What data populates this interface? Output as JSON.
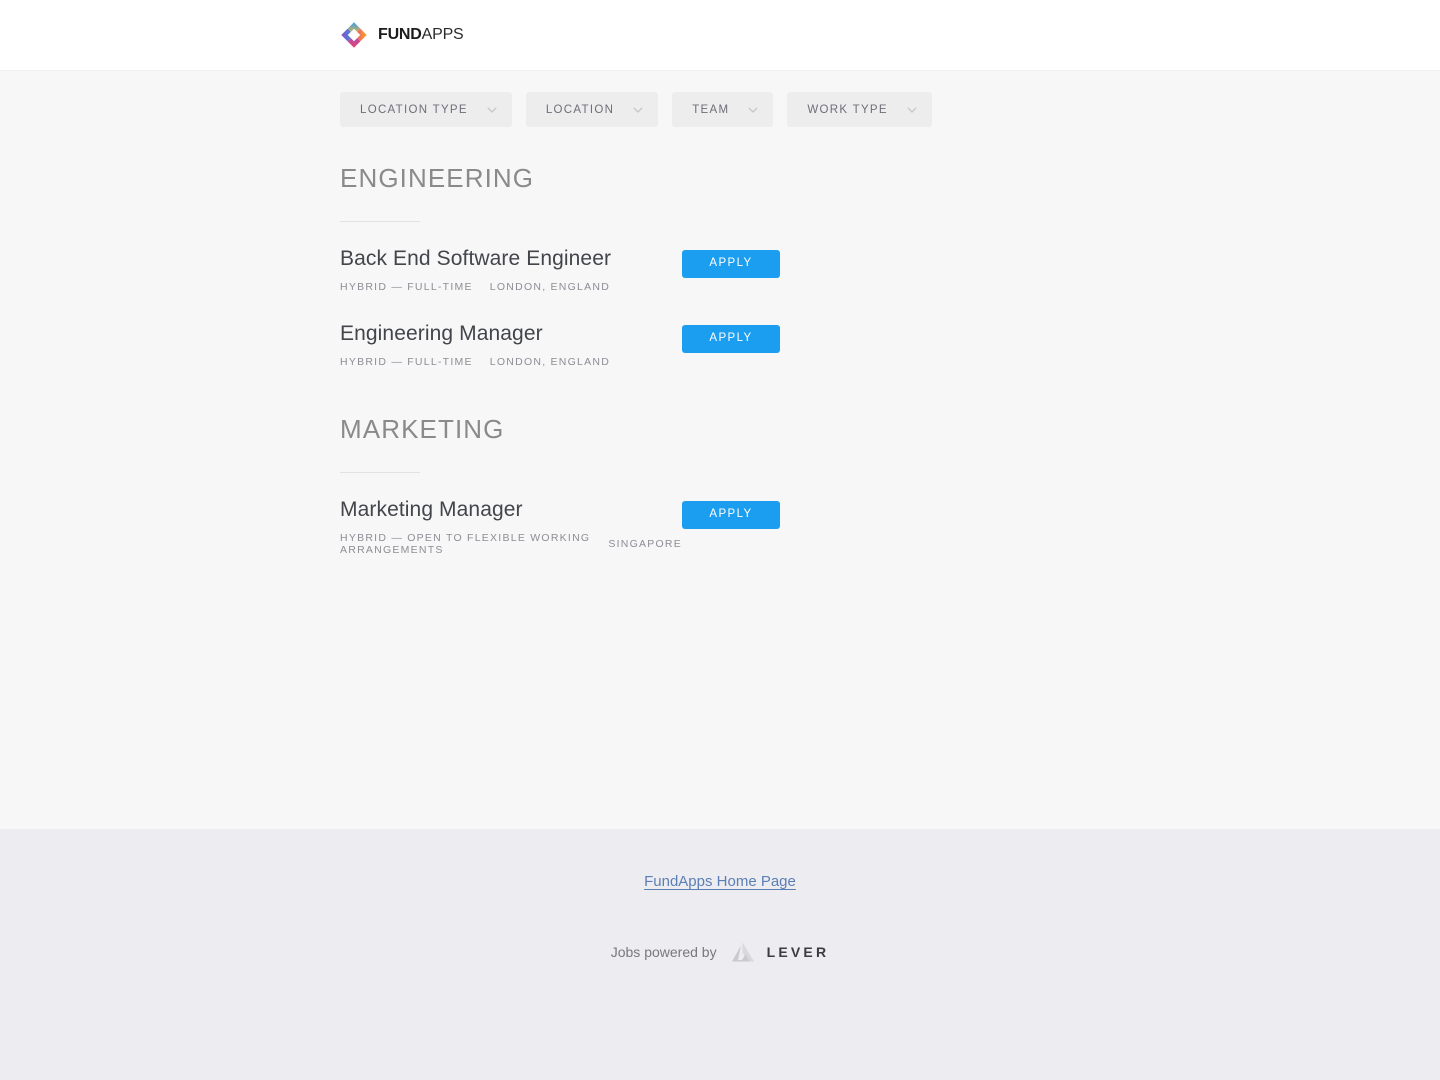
{
  "header": {
    "logo_icon": "fundapps-diamond-logo",
    "brand_bold": "FUND",
    "brand_light": "APPS",
    "logo_colors": [
      "#2f9ae0",
      "#f5a623",
      "#ec4899",
      "#8b4fc8",
      "#e8456c"
    ]
  },
  "filters": {
    "chevron_icon": "chevron-down-icon",
    "items": [
      {
        "label": "LOCATION TYPE",
        "key": "location-type"
      },
      {
        "label": "LOCATION",
        "key": "location"
      },
      {
        "label": "TEAM",
        "key": "team"
      },
      {
        "label": "WORK TYPE",
        "key": "work-type"
      }
    ]
  },
  "departments": [
    {
      "name": "ENGINEERING",
      "postings": [
        {
          "title": "Back End Software Engineer",
          "commitment": "HYBRID — FULL-TIME",
          "location": "LONDON, ENGLAND",
          "apply_label": "APPLY"
        },
        {
          "title": "Engineering Manager",
          "commitment": "HYBRID — FULL-TIME",
          "location": "LONDON, ENGLAND",
          "apply_label": "APPLY"
        }
      ]
    },
    {
      "name": "MARKETING",
      "postings": [
        {
          "title": "Marketing Manager",
          "commitment": "HYBRID — OPEN TO FLEXIBLE WORKING ARRANGEMENTS",
          "location": "SINGAPORE",
          "apply_label": "APPLY"
        }
      ]
    }
  ],
  "footer": {
    "home_link": "FundApps Home Page",
    "powered_by_label": "Jobs powered by",
    "lever_wordmark": "LEVER",
    "lever_icon": "lever-chevron-logo"
  },
  "colors": {
    "accent_blue": "#1c9ef0",
    "page_bg": "#f7f7f8",
    "footer_bg": "#edecf0",
    "link_blue": "#5b7fb5"
  }
}
